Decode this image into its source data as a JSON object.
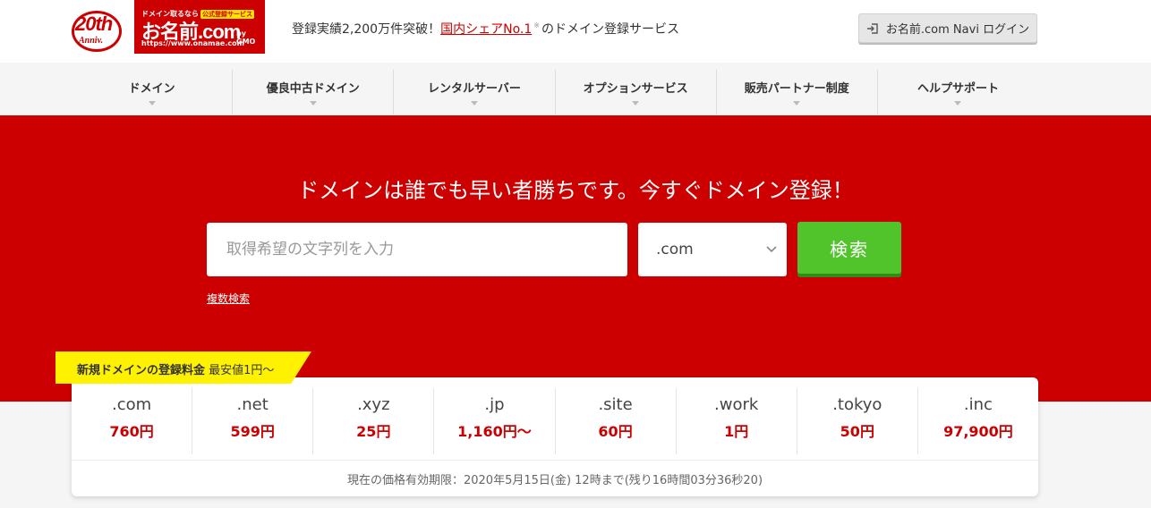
{
  "header": {
    "anniv_num": "20th",
    "anniv_sub": "Anniv.",
    "logo_top": "ドメイン取るなら",
    "logo_tag": "公式登録サービス",
    "logo_main": "お名前.com",
    "logo_gmo": "by GMO",
    "logo_url": "https://www.onamae.com",
    "tagline_pre": "登録実績2,200万件突破！",
    "tagline_highlight": "国内シェアNo.1",
    "tagline_reg": "※",
    "tagline_post": "のドメイン登録サービス",
    "login_label": "お名前.com Navi ログイン"
  },
  "nav": {
    "items": [
      {
        "label": "ドメイン"
      },
      {
        "label": "優良中古ドメイン"
      },
      {
        "label": "レンタルサーバー"
      },
      {
        "label": "オプションサービス"
      },
      {
        "label": "販売パートナー制度"
      },
      {
        "label": "ヘルプサポート"
      }
    ]
  },
  "hero": {
    "title": "ドメインは誰でも早い者勝ちです。今すぐドメイン登録！",
    "search_placeholder": "取得希望の文字列を入力",
    "tld_selected": ".com",
    "search_button": "検索",
    "multi_search_link": "複数検索"
  },
  "pricing": {
    "badge_bold": "新規ドメインの登録料金",
    "badge_rest": "最安値1円〜",
    "items": [
      {
        "tld": ".com",
        "price": "760円"
      },
      {
        "tld": ".net",
        "price": "599円"
      },
      {
        "tld": ".xyz",
        "price": "25円"
      },
      {
        "tld": ".jp",
        "price": "1,160円〜"
      },
      {
        "tld": ".site",
        "price": "60円"
      },
      {
        "tld": ".work",
        "price": "1円"
      },
      {
        "tld": ".tokyo",
        "price": "50円"
      },
      {
        "tld": ".inc",
        "price": "97,900円"
      }
    ],
    "validity_note": "現在の価格有効期限：2020年5月15日(金) 12時まで(残り16時間03分36秒20)"
  },
  "colors": {
    "brand_red": "#cc0000",
    "search_green": "#52c42b",
    "badge_yellow": "#fff200"
  }
}
